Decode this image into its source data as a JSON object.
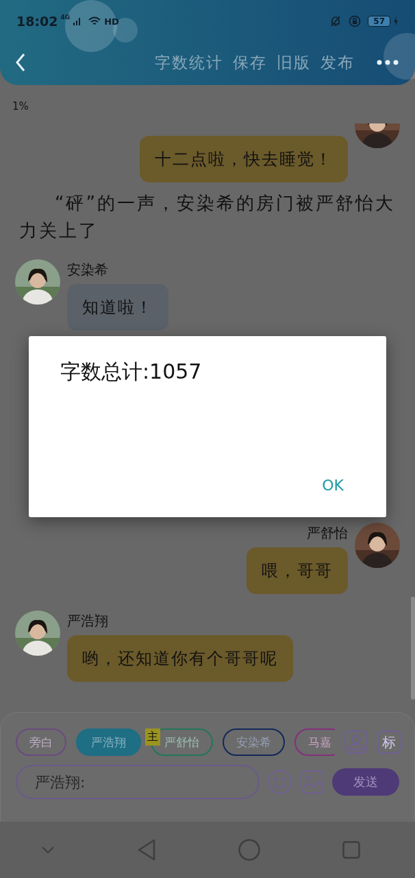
{
  "status_bar": {
    "time": "18:02",
    "network": "4G",
    "hd": "HD",
    "battery": "57"
  },
  "header": {
    "actions": [
      "字数统计",
      "保存",
      "旧版",
      "发布"
    ]
  },
  "progress_text": "1%",
  "messages": [
    {
      "kind": "right",
      "text": "十二点啦，快去睡觉！",
      "color": "#6b5a2a"
    },
    {
      "kind": "narration",
      "text": "“砰”的一声，安染希的房门被严舒怡大力关上了"
    },
    {
      "kind": "left",
      "name": "安染希",
      "text": "知道啦！",
      "color": "#5a6169"
    },
    {
      "kind": "right",
      "name": "严舒怡",
      "text": "喂，哥哥",
      "color": "#6b5a2a"
    },
    {
      "kind": "left",
      "name": "严浩翔",
      "text": "哟，还知道你有个哥哥呢",
      "color": "#6b5a2a"
    }
  ],
  "dialog": {
    "message": "字数总计:1057",
    "button": "OK"
  },
  "roles": [
    {
      "label": "旁白",
      "color": "#6a4a7e",
      "selected": false
    },
    {
      "label": "严浩翔",
      "color": "#1e6e84",
      "selected": true
    },
    {
      "label": "严舒怡",
      "color": "#22765a",
      "selected": false,
      "tag": "主"
    },
    {
      "label": "安染希",
      "color": "#12285a",
      "selected": false
    },
    {
      "label": "马嘉",
      "color": "#84307a",
      "selected": false
    }
  ],
  "tag_button": "标",
  "input": {
    "placeholder": "严浩翔:"
  },
  "send_button": "发送"
}
